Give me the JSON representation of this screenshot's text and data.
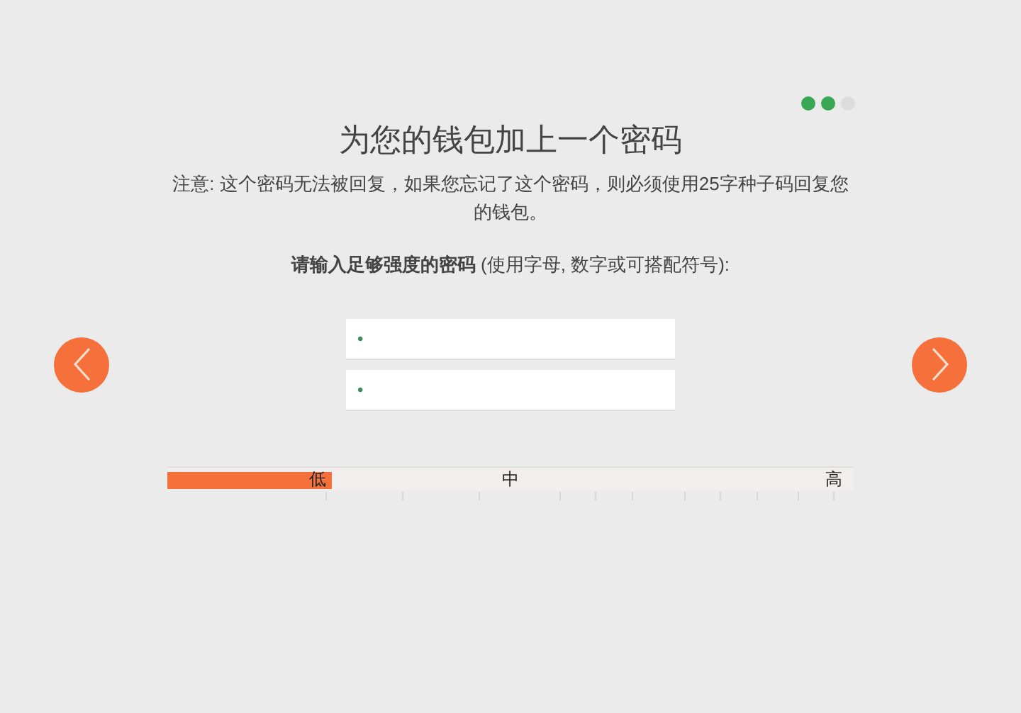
{
  "steps": [
    {
      "done": true
    },
    {
      "done": true
    },
    {
      "done": false
    }
  ],
  "title": "为您的钱包加上一个密码",
  "note": "注意: 这个密码无法被回复，如果您忘记了这个密码，则必须使用25字种子码回复您的钱包。",
  "prompt": "**请输入足够强度的密码** (使用字母, 数字或可搭配符号):",
  "fields": [
    {
      "value": "•"
    },
    {
      "value": "•"
    }
  ],
  "strength": {
    "level": 0.24,
    "labels": [
      "低",
      "中",
      "高"
    ]
  }
}
